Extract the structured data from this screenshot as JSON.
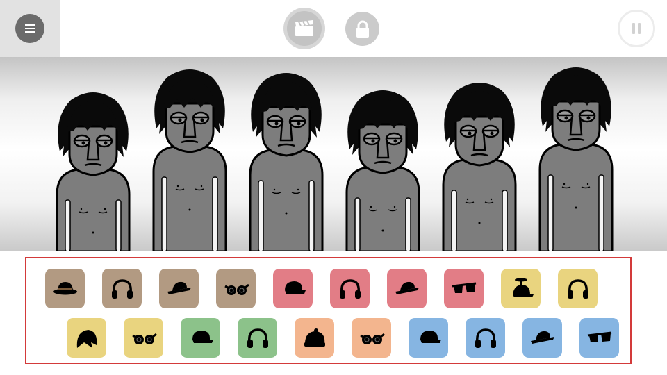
{
  "toolbar": {
    "menu_icon": "hamburger-menu-icon",
    "record_icon": "clapperboard-icon",
    "lock_icon": "padlock-icon",
    "pause_icon": "pause-icon"
  },
  "stage": {
    "performer_count": 6,
    "performers": [
      {
        "slot": 1,
        "state": "idle"
      },
      {
        "slot": 2,
        "state": "idle"
      },
      {
        "slot": 3,
        "state": "idle"
      },
      {
        "slot": 4,
        "state": "idle"
      },
      {
        "slot": 5,
        "state": "idle"
      },
      {
        "slot": 6,
        "state": "idle"
      }
    ]
  },
  "palette": {
    "highlight_color": "#d33a3a",
    "group_colors": {
      "brown": "#b29a82",
      "red": "#e27d86",
      "yellow": "#e9d47f",
      "green": "#8cc28a",
      "orange": "#f3b58e",
      "blue": "#86b5e2"
    },
    "rows": [
      [
        {
          "name": "fedora-hat-icon",
          "group": "brown",
          "icon": "hat"
        },
        {
          "name": "headphones-icon",
          "group": "brown",
          "icon": "headphones"
        },
        {
          "name": "trilby-hat-icon",
          "group": "brown",
          "icon": "trilby"
        },
        {
          "name": "goggles-icon",
          "group": "brown",
          "icon": "goggles"
        },
        {
          "name": "cap-icon",
          "group": "red",
          "icon": "cap"
        },
        {
          "name": "headphones-icon",
          "group": "red",
          "icon": "headphones"
        },
        {
          "name": "trilby-hat-icon",
          "group": "red",
          "icon": "trilby"
        },
        {
          "name": "sunglasses-icon",
          "group": "red",
          "icon": "sunglasses"
        },
        {
          "name": "propeller-cap-icon",
          "group": "yellow",
          "icon": "propeller"
        },
        {
          "name": "headphones-icon",
          "group": "yellow",
          "icon": "headphones"
        }
      ],
      [
        {
          "name": "hood-icon",
          "group": "yellow",
          "icon": "hood"
        },
        {
          "name": "goggles-icon",
          "group": "yellow",
          "icon": "goggles"
        },
        {
          "name": "cap-icon",
          "group": "green",
          "icon": "cap"
        },
        {
          "name": "headphones-icon",
          "group": "green",
          "icon": "headphones"
        },
        {
          "name": "beanie-icon",
          "group": "orange",
          "icon": "beanie"
        },
        {
          "name": "goggles-icon",
          "group": "orange",
          "icon": "goggles"
        },
        {
          "name": "cap-icon",
          "group": "blue",
          "icon": "cap"
        },
        {
          "name": "headphones-icon",
          "group": "blue",
          "icon": "headphones"
        },
        {
          "name": "trilby-hat-icon",
          "group": "blue",
          "icon": "trilby"
        },
        {
          "name": "sunglasses-icon",
          "group": "blue",
          "icon": "sunglasses"
        }
      ]
    ]
  }
}
